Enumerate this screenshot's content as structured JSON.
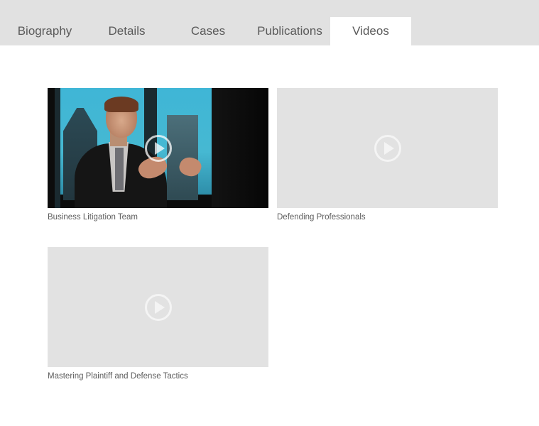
{
  "tabs": [
    {
      "label": "Biography",
      "active": false
    },
    {
      "label": "Details",
      "active": false
    },
    {
      "label": "Cases",
      "active": false
    },
    {
      "label": "Publications",
      "active": false
    },
    {
      "label": "Videos",
      "active": true
    }
  ],
  "videos": [
    {
      "title": "Business Litigation Team",
      "thumbnail": "photo-of-speaker",
      "icon": "play-icon"
    },
    {
      "title": "Defending Professionals",
      "thumbnail": "placeholder",
      "icon": "play-icon"
    },
    {
      "title": "Mastering Plaintiff and Defense Tactics",
      "thumbnail": "placeholder",
      "icon": "play-icon"
    }
  ],
  "colors": {
    "tabbar_bg": "#e1e1e1",
    "active_tab_bg": "#ffffff",
    "placeholder_bg": "#e2e2e2",
    "text": "#5a5a5a"
  }
}
